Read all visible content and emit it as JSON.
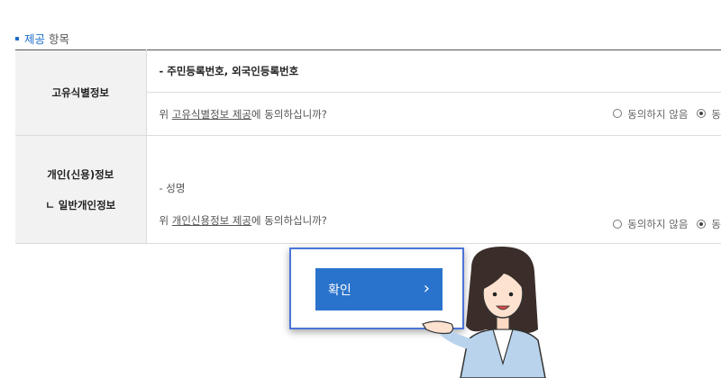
{
  "section": {
    "highlight": "제공",
    "rest": " 항목"
  },
  "rows": [
    {
      "head": "고유식별정보",
      "item": "- 주민등록번호, 외국인등록번호",
      "question_prefix": "위 ",
      "question_link": "고유식별정보 제공",
      "question_suffix": "에 동의하십니까?",
      "option_no": "동의하지 않음",
      "option_yes": "동"
    },
    {
      "head_line1": "개인(신용)정보",
      "head_line2": "ㄴ 일반개인정보",
      "item": "- 성명",
      "question_prefix": "위 ",
      "question_link": "개인신용정보 제공",
      "question_suffix": "에 동의하십니까?",
      "option_no": "동의하지 않음",
      "option_yes": "동"
    }
  ],
  "confirm": {
    "label": "확인",
    "icon": "chevron-right-icon",
    "color": "#2a73cc",
    "frame_color": "#4a74d9"
  },
  "illustration": {
    "name": "assistant-character"
  }
}
